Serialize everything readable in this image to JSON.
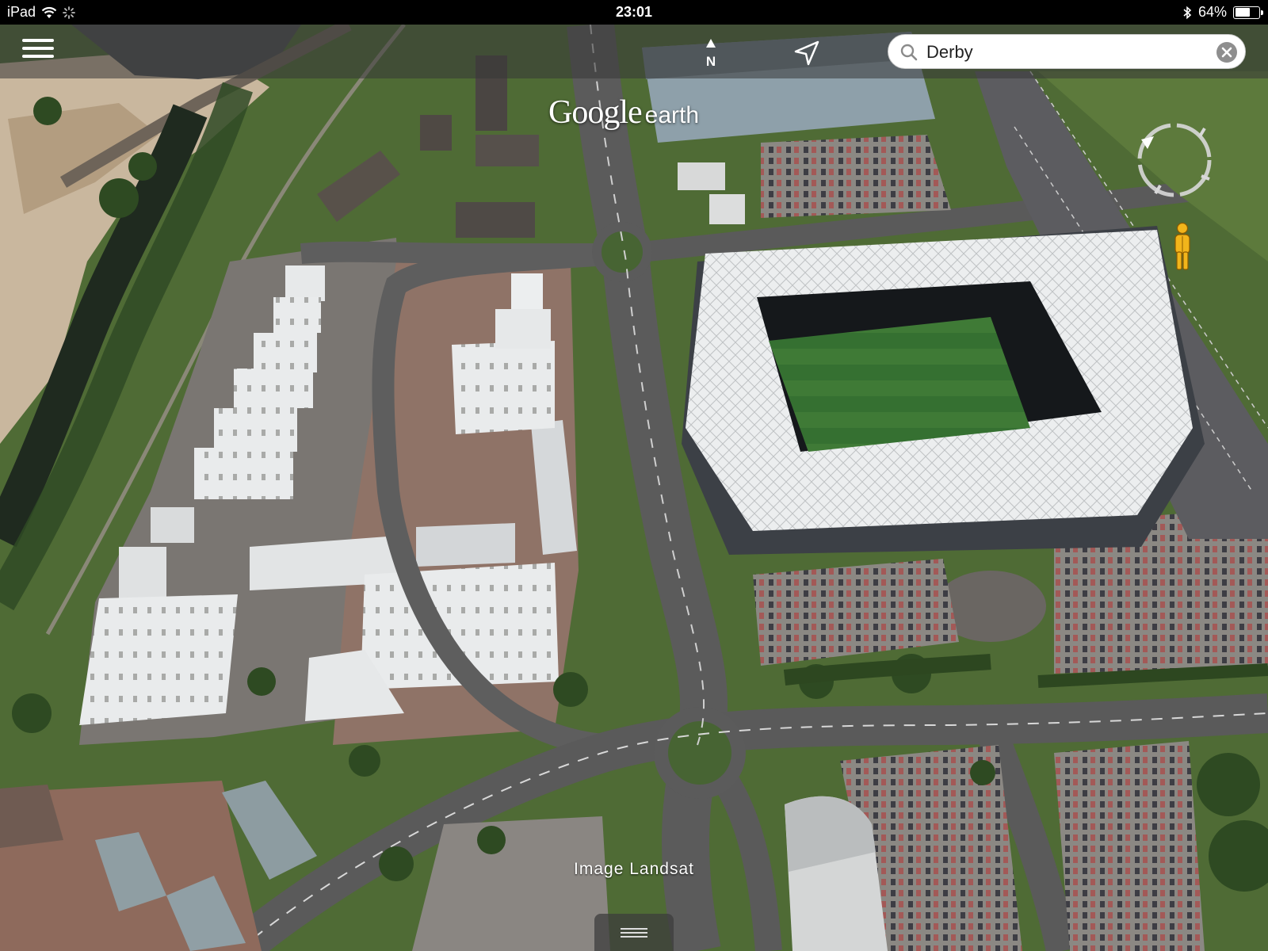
{
  "status_bar": {
    "device": "iPad",
    "time": "23:01",
    "battery_percent_label": "64%",
    "battery_level": 0.64
  },
  "toolbar": {
    "compass_label": "N"
  },
  "search": {
    "value": "Derby"
  },
  "logo": {
    "google": "Google",
    "earth": "earth"
  },
  "attribution": {
    "text": "Image Landsat"
  },
  "colors": {
    "grass": "#4f6b35",
    "road": "#5b5b5b",
    "roof": "#e7e9ea",
    "parking": "#8a8682",
    "river": "#1f2a1f",
    "pegman": "#f2b51b"
  }
}
